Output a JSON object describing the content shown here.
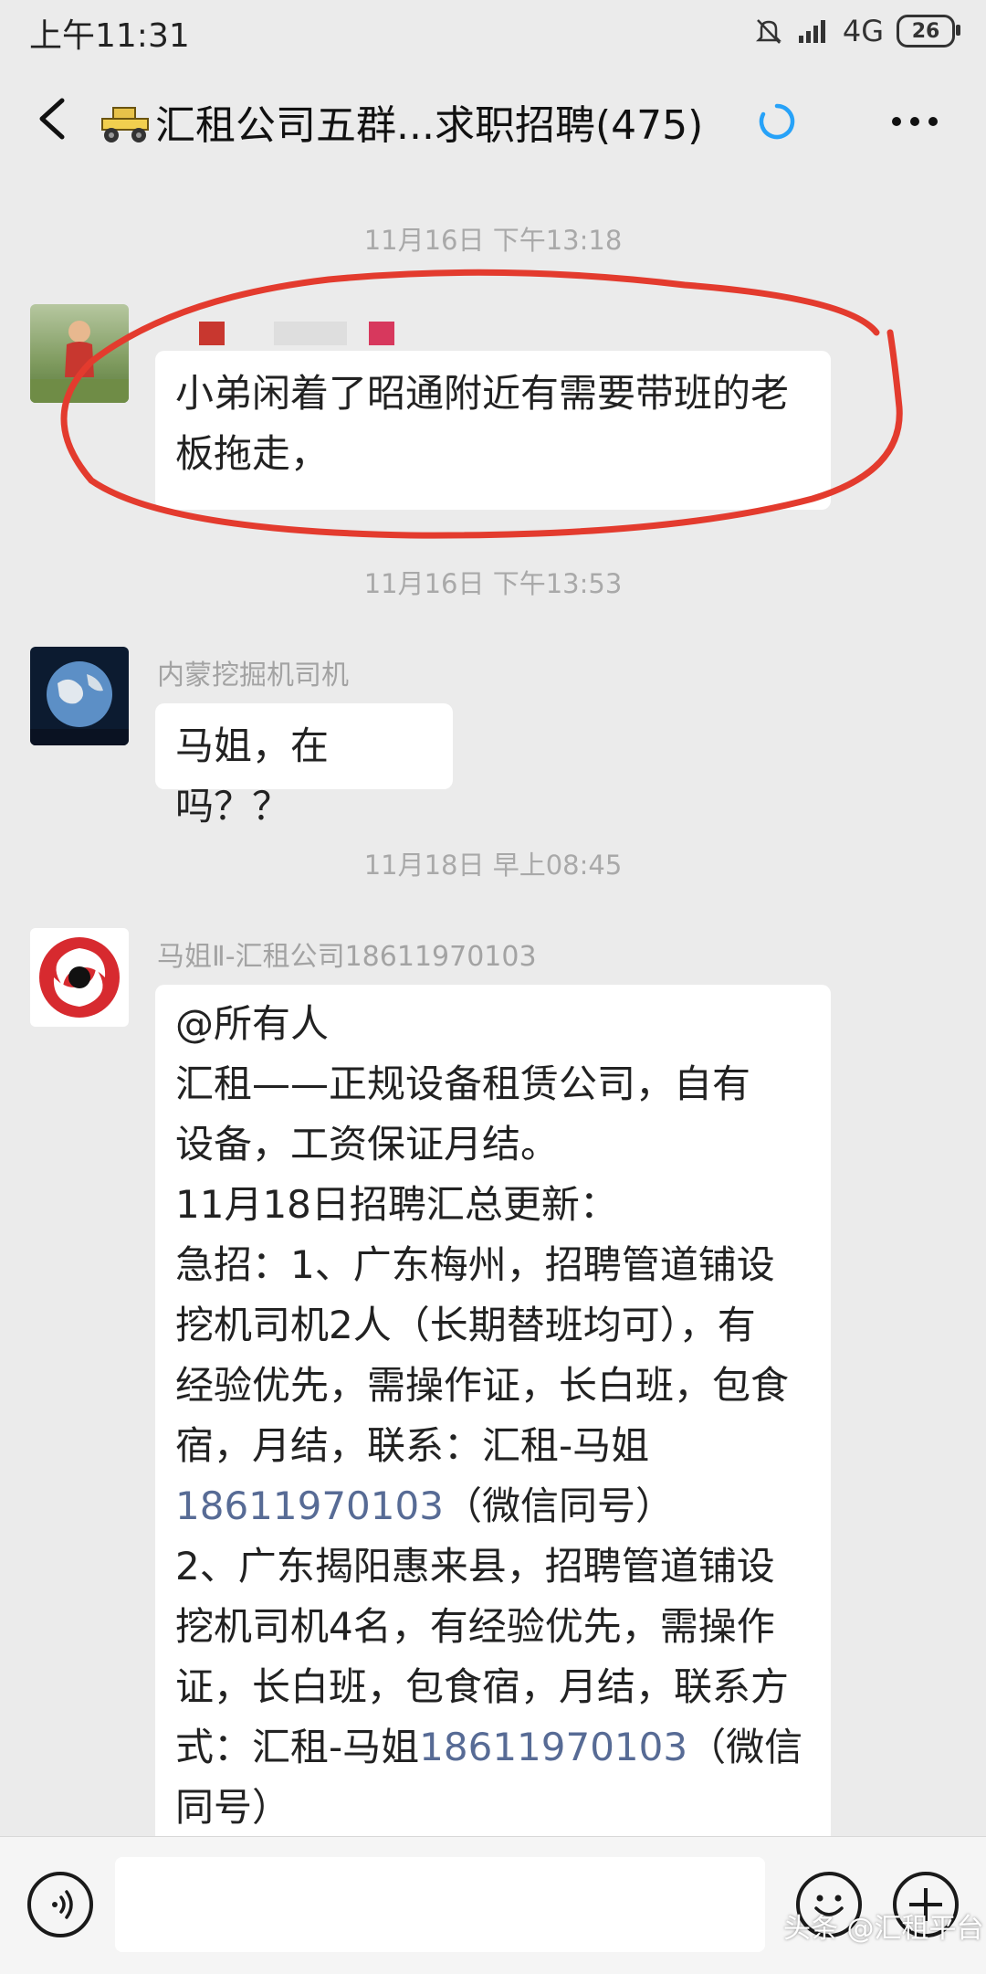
{
  "status_bar": {
    "time": "上午11:31",
    "network": "4G",
    "battery": "26"
  },
  "header": {
    "title": "汇租公司五群...求职招聘(475)",
    "icons": {
      "back": "chevron-left-icon",
      "group": "tractor-icon",
      "loading": "loading-ring-icon",
      "more": "more-dots-icon"
    },
    "accent_color": "#27a2f8"
  },
  "messages": [
    {
      "timestamp": "11月16日 下午13:18",
      "sender": "",
      "text": "小弟闲着了昭通附近有需要带班的老板拖走，",
      "annotation_color": "#e33b2e"
    },
    {
      "timestamp": "11月16日 下午13:53",
      "sender": "内蒙挖掘机司机",
      "text": "马姐，在吗？？"
    },
    {
      "timestamp": "11月18日 早上08:45",
      "sender": "马姐Ⅱ-汇租公司18611970103",
      "lines": [
        "@所有人",
        "汇租——正规设备租赁公司，自有",
        "设备，工资保证月结。",
        "11月18日招聘汇总更新：",
        "急招：1、广东梅州，招聘管道铺设",
        "挖机司机2人（长期替班均可），有",
        "经验优先，需操作证，长白班，包食",
        "宿，月结，联系：汇租-马姐"
      ],
      "phone_1": "18611970103",
      "after_phone_1": "（微信同号）",
      "lines_2": [
        "2、广东揭阳惠来县，招聘管道铺设",
        "挖机司机4名，有经验优先，需操作",
        "证，长白班，包食宿，月结，联系方"
      ],
      "line_before_phone_2": "式：汇租-马姐",
      "phone_2": "18611970103",
      "after_phone_2": "（微信",
      "last_line": "同号）"
    }
  ],
  "input_bar": {
    "placeholder": "",
    "icons": {
      "voice": "voice-icon",
      "emoji": "emoji-icon",
      "add": "add-icon"
    }
  },
  "watermark": "头条 @汇租平台"
}
